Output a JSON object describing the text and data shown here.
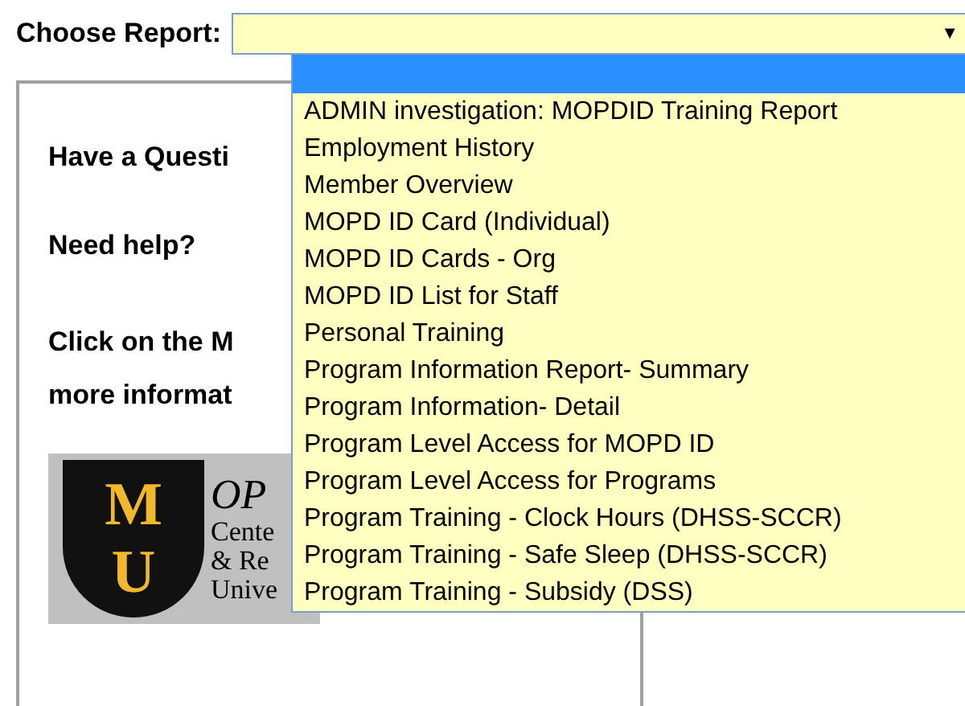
{
  "label": "Choose Report:",
  "select": {
    "arrow": "▼",
    "expanded": true
  },
  "dropdown": {
    "blank_option": {
      "selected": true
    },
    "options": [
      {
        "label": "ADMIN investigation: MOPDID Training Report",
        "selected": false
      },
      {
        "label": "Employment History",
        "selected": false
      },
      {
        "label": "Member Overview",
        "selected": false
      },
      {
        "label": "MOPD ID Card (Individual)",
        "selected": false
      },
      {
        "label": "MOPD ID Cards - Org",
        "selected": false
      },
      {
        "label": "MOPD ID List for Staff",
        "selected": false
      },
      {
        "label": "Personal Training",
        "selected": false
      },
      {
        "label": "Program Information Report- Summary",
        "selected": false
      },
      {
        "label": "Program Information- Detail",
        "selected": false
      },
      {
        "label": "Program Level Access for MOPD ID",
        "selected": false
      },
      {
        "label": "Program Level Access for Programs",
        "selected": false
      },
      {
        "label": "Program Training - Clock Hours (DHSS-SCCR)",
        "selected": false
      },
      {
        "label": "Program Training - Safe Sleep (DHSS-SCCR)",
        "selected": false
      },
      {
        "label": "Program Training - Subsidy (DSS)",
        "selected": false
      }
    ]
  },
  "panel": {
    "paragraphs": [
      "Have a Questi",
      "Need help?"
    ],
    "lines": [
      "Click on the M",
      "more informat"
    ],
    "logo": {
      "shield_letters": [
        "M",
        "U"
      ],
      "title": "OP",
      "lines": [
        "Cente",
        "& Re",
        "Unive"
      ]
    }
  }
}
